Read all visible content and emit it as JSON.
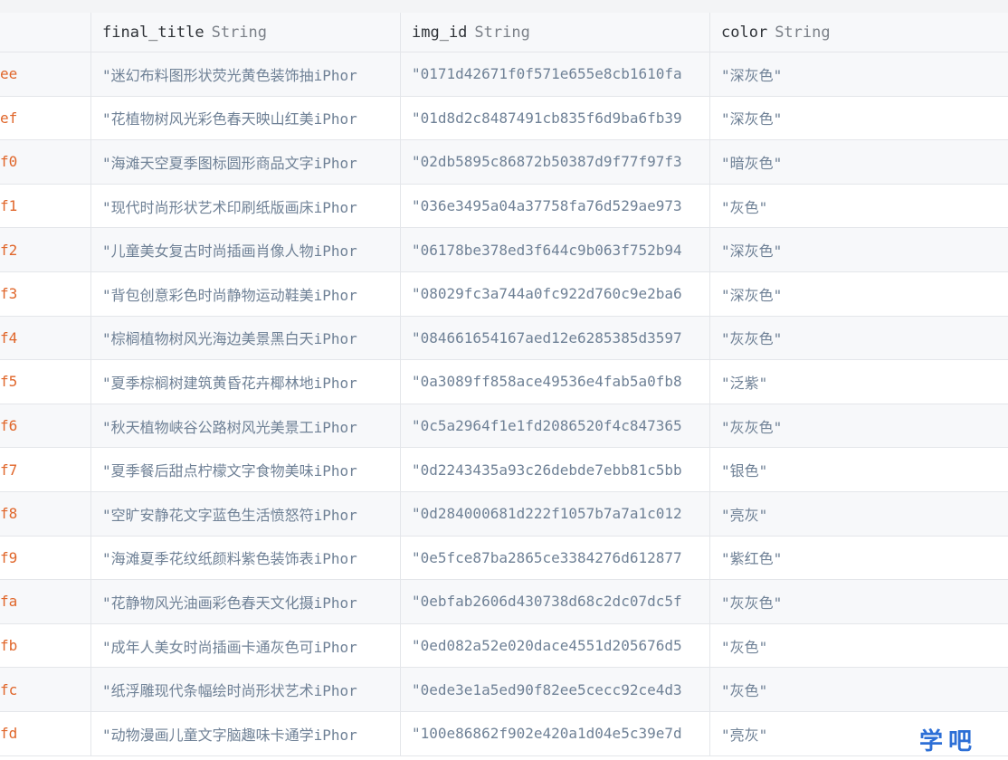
{
  "header": {
    "columns": [
      {
        "name": "",
        "type": ""
      },
      {
        "name": "final_title",
        "type": "String"
      },
      {
        "name": "img_id",
        "type": "String"
      },
      {
        "name": "color",
        "type": "String"
      }
    ]
  },
  "rows": [
    {
      "key": "ee",
      "final_title": "\"迷幻布料图形状荧光黄色装饰抽iPhor",
      "img_id": "\"0171d42671f0f571e655e8cb1610fa",
      "color": "\"深灰色\""
    },
    {
      "key": "ef",
      "final_title": "\"花植物树风光彩色春天映山红美iPhor",
      "img_id": "\"01d8d2c8487491cb835f6d9ba6fb39",
      "color": "\"深灰色\""
    },
    {
      "key": "f0",
      "final_title": "\"海滩天空夏季图标圆形商品文字iPhor",
      "img_id": "\"02db5895c86872b50387d9f77f97f3",
      "color": "\"暗灰色\""
    },
    {
      "key": "f1",
      "final_title": "\"现代时尚形状艺术印刷纸版画床iPhor",
      "img_id": "\"036e3495a04a37758fa76d529ae973",
      "color": "\"灰色\""
    },
    {
      "key": "f2",
      "final_title": "\"儿童美女复古时尚插画肖像人物iPhor",
      "img_id": "\"06178be378ed3f644c9b063f752b94",
      "color": "\"深灰色\""
    },
    {
      "key": "f3",
      "final_title": "\"背包创意彩色时尚静物运动鞋美iPhor",
      "img_id": "\"08029fc3a744a0fc922d760c9e2ba6",
      "color": "\"深灰色\""
    },
    {
      "key": "f4",
      "final_title": "\"棕榈植物树风光海边美景黑白天iPhor",
      "img_id": "\"084661654167aed12e6285385d3597",
      "color": "\"灰灰色\""
    },
    {
      "key": "f5",
      "final_title": "\"夏季棕榈树建筑黄昏花卉椰林地iPhor",
      "img_id": "\"0a3089ff858ace49536e4fab5a0fb8",
      "color": "\"泛紫\""
    },
    {
      "key": "f6",
      "final_title": "\"秋天植物峡谷公路树风光美景工iPhor",
      "img_id": "\"0c5a2964f1e1fd2086520f4c847365",
      "color": "\"灰灰色\""
    },
    {
      "key": "f7",
      "final_title": "\"夏季餐后甜点柠檬文字食物美味iPhor",
      "img_id": "\"0d2243435a93c26debde7ebb81c5bb",
      "color": "\"银色\""
    },
    {
      "key": "f8",
      "final_title": "\"空旷安静花文字蓝色生活愤怒符iPhor",
      "img_id": "\"0d284000681d222f1057b7a7a1c012",
      "color": "\"亮灰\""
    },
    {
      "key": "f9",
      "final_title": "\"海滩夏季花纹纸颜料紫色装饰表iPhor",
      "img_id": "\"0e5fce87ba2865ce3384276d612877",
      "color": "\"紫红色\""
    },
    {
      "key": "fa",
      "final_title": "\"花静物风光油画彩色春天文化摄iPhor",
      "img_id": "\"0ebfab2606d430738d68c2dc07dc5f",
      "color": "\"灰灰色\""
    },
    {
      "key": "fb",
      "final_title": "\"成年人美女时尚插画卡通灰色可iPhor",
      "img_id": "\"0ed082a52e020dace4551d205676d5",
      "color": "\"灰色\""
    },
    {
      "key": "fc",
      "final_title": "\"纸浮雕现代条幅绘时尚形状艺术iPhor",
      "img_id": "\"0ede3e1a5ed90f82ee5cecc92ce4d3",
      "color": "\"灰色\""
    },
    {
      "key": "fd",
      "final_title": "\"动物漫画儿童文字脑趣味卡通学iPhor",
      "img_id": "\"100e86862f902e420a1d04e5c39e7d",
      "color": "\"亮灰\""
    }
  ],
  "watermark": "学吧",
  "colors": {
    "key_text": "#e0662a",
    "value_text": "#6f8196",
    "header_text": "#2f3338",
    "type_text": "#7b8088",
    "grid_line": "#e4e6ea",
    "watermark": "#2d6fd6"
  }
}
